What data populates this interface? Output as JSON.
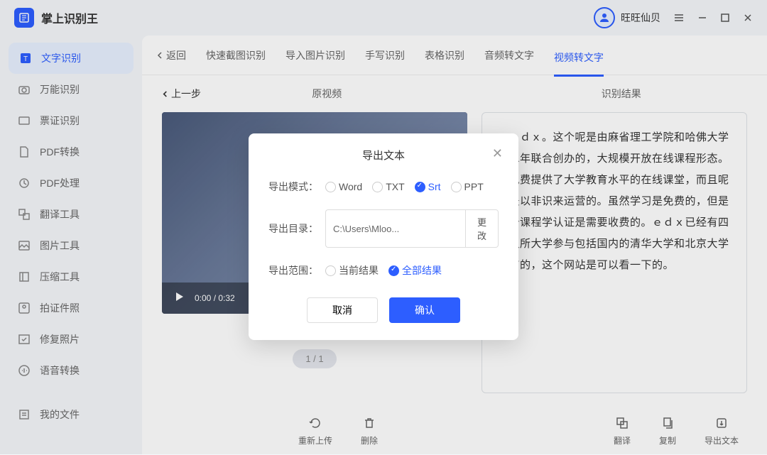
{
  "app": {
    "title": "掌上识别王"
  },
  "user": {
    "name": "旺旺仙贝"
  },
  "sidebar": {
    "items": [
      {
        "label": "文字识别"
      },
      {
        "label": "万能识别"
      },
      {
        "label": "票证识别"
      },
      {
        "label": "PDF转换"
      },
      {
        "label": "PDF处理"
      },
      {
        "label": "翻译工具"
      },
      {
        "label": "图片工具"
      },
      {
        "label": "压缩工具"
      },
      {
        "label": "拍证件照"
      },
      {
        "label": "修复照片"
      },
      {
        "label": "语音转换"
      },
      {
        "label": "我的文件"
      }
    ]
  },
  "tabs": {
    "back": "返回",
    "items": [
      {
        "label": "快速截图识别"
      },
      {
        "label": "导入图片识别"
      },
      {
        "label": "手写识别"
      },
      {
        "label": "表格识别"
      },
      {
        "label": "音频转文字"
      },
      {
        "label": "视频转文字"
      }
    ]
  },
  "sub": {
    "prev": "上一步",
    "left": "原视频",
    "right": "识别结果"
  },
  "video": {
    "time": "0:00 / 0:32"
  },
  "pager": {
    "label": "1 / 1"
  },
  "result": {
    "text": "　ｅｄｘ。这个呢是由麻省理工学院和哈佛大学在二年联合创办的，大规模开放在线课程形态。他免费提供了大学教育水平的在线课堂，而且呢还是以非识来运营的。虽然学习是免费的，但是一个课程学认证是需要收费的。ｅｄｘ已经有四十八所大学参与包括国内的清华大学和北京大学都有的，这个网站是可以看一下的。"
  },
  "footer": {
    "reupload": "重新上传",
    "delete": "删除",
    "translate": "翻译",
    "copy": "复制",
    "export": "导出文本"
  },
  "modal": {
    "title": "导出文本",
    "mode_label": "导出模式：",
    "modes": {
      "word": "Word",
      "txt": "TXT",
      "srt": "Srt",
      "ppt": "PPT"
    },
    "dir_label": "导出目录：",
    "dir_value": "C:\\Users\\Mloo...",
    "dir_change": "更改",
    "range_label": "导出范围：",
    "range_current": "当前结果",
    "range_all": "全部结果",
    "cancel": "取消",
    "confirm": "确认"
  }
}
